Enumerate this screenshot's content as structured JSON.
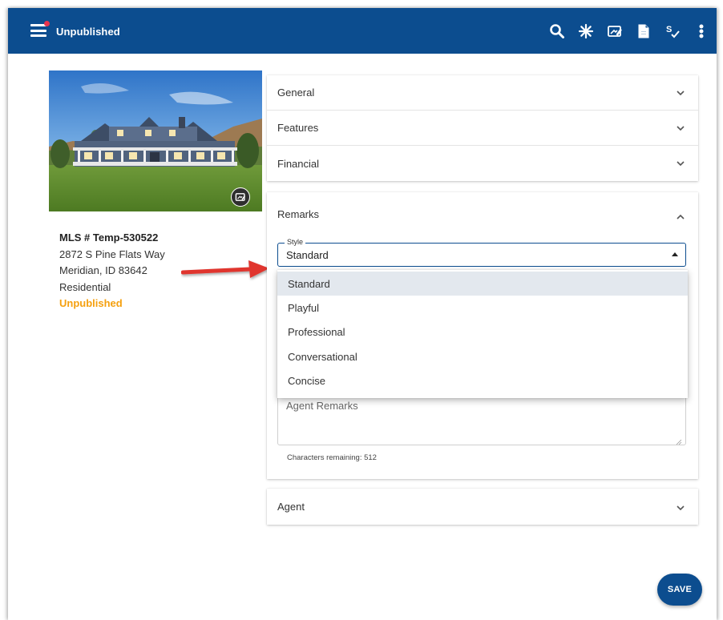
{
  "app": {
    "title": "Unpublished",
    "accent_color": "#0c4d8f",
    "notification_dot_color": "#e8344e"
  },
  "toolbar": {
    "icons": [
      "search-icon",
      "asterisk-icon",
      "edit-photo-icon",
      "document-icon",
      "spellcheck-icon",
      "more-vert-icon"
    ]
  },
  "listing": {
    "mls": "MLS # Temp-530522",
    "street": "2872 S Pine Flats Way",
    "city_state_zip": "Meridian, ID 83642",
    "type": "Residential",
    "status": "Unpublished",
    "status_color": "#f5a00f"
  },
  "sections": {
    "general": "General",
    "features": "Features",
    "financial": "Financial",
    "remarks": "Remarks",
    "agent": "Agent"
  },
  "remarks": {
    "style_label": "Style",
    "style_value": "Standard",
    "style_options": [
      "Standard",
      "Playful",
      "Professional",
      "Conversational",
      "Concise"
    ],
    "agent_remarks_placeholder": "Agent Remarks",
    "chars_remaining": "Characters remaining: 512"
  },
  "actions": {
    "save_label": "SAVE"
  }
}
